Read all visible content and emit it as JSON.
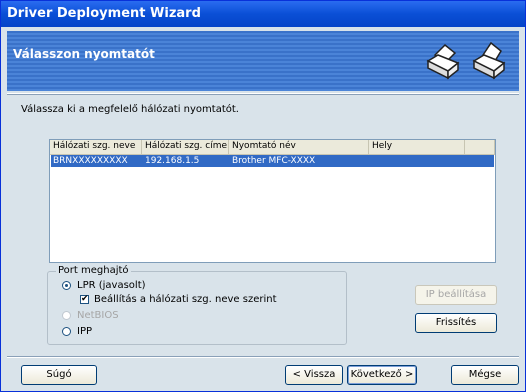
{
  "window": {
    "title": "Driver Deployment Wizard"
  },
  "header": {
    "heading": "Válasszon nyomtatót",
    "icons": [
      "printer-icon",
      "printer-icon"
    ]
  },
  "instruction": "Válassza ki a megfelelő hálózati nyomtatót.",
  "printer_list": {
    "columns": [
      "Hálózati szg. neve",
      "Hálózati szg. címe",
      "Nyomtató név",
      "Hely"
    ],
    "rows": [
      {
        "name": "BRNXXXXXXXXX",
        "address": "192.168.1.5",
        "printer": "Brother MFC-XXXX",
        "location": "",
        "selected": true
      }
    ]
  },
  "port_group": {
    "label": "Port meghajtó",
    "options": [
      {
        "label": "LPR (javasolt)",
        "selected": true,
        "enabled": true
      },
      {
        "label": "NetBIOS",
        "selected": false,
        "enabled": false
      },
      {
        "label": "IPP",
        "selected": false,
        "enabled": true
      }
    ],
    "checkbox": {
      "label": "Beállítás a hálózati szg. neve szerint",
      "checked": true
    }
  },
  "buttons": {
    "ip_settings": "IP beállítása",
    "refresh": "Frissítés",
    "help": "Súgó",
    "back": "< Vissza",
    "next": "Következő >",
    "cancel": "Mégse"
  },
  "colors": {
    "title_bar": "#0a4fd6",
    "header_band": "#4b84d8",
    "selection": "#316ac5",
    "background": "#d9e3ea"
  }
}
